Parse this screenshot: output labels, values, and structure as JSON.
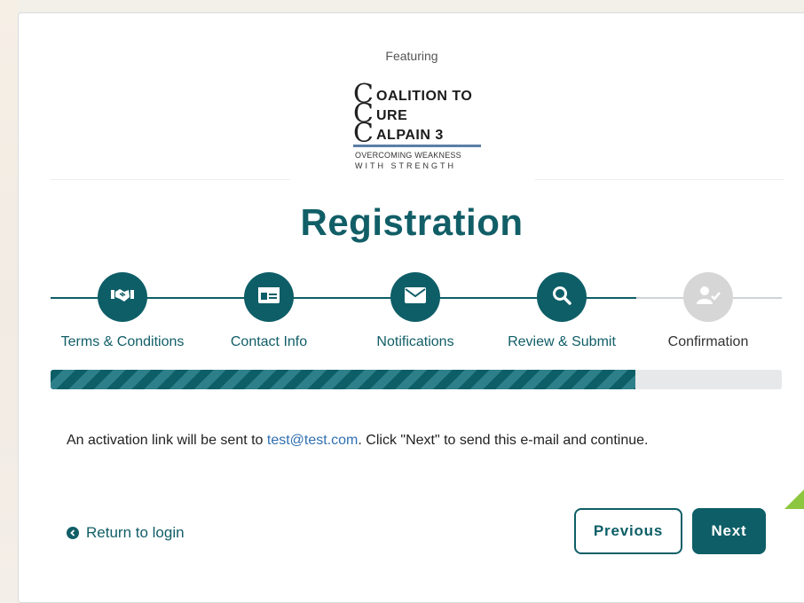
{
  "header": {
    "featuring": "Featuring",
    "logo": {
      "line1": "OALITION TO",
      "line2": "URE",
      "line3": "ALPAIN 3",
      "tagline1": "OVERCOMING WEAKNESS",
      "tagline2": "WITH STRENGTH"
    }
  },
  "page": {
    "title": "Registration"
  },
  "steps": [
    {
      "label": "Terms & Conditions",
      "icon": "handshake-icon",
      "state": "complete"
    },
    {
      "label": "Contact Info",
      "icon": "id-card-icon",
      "state": "complete"
    },
    {
      "label": "Notifications",
      "icon": "envelope-icon",
      "state": "complete"
    },
    {
      "label": "Review & Submit",
      "icon": "search-icon",
      "state": "current"
    },
    {
      "label": "Confirmation",
      "icon": "user-check-icon",
      "state": "pending"
    }
  ],
  "progress": {
    "percent": 80
  },
  "message": {
    "prefix": "An activation link will be sent to ",
    "email": "test@test.com",
    "suffix": ". Click \"Next\" to send this e-mail and continue."
  },
  "actions": {
    "return_label": "Return to login",
    "previous_label": "Previous",
    "next_label": "Next"
  },
  "colors": {
    "primary": "#0e5e67",
    "link": "#2f6fb0",
    "inactive": "#d6d6d6",
    "accent": "#8dc63f"
  }
}
